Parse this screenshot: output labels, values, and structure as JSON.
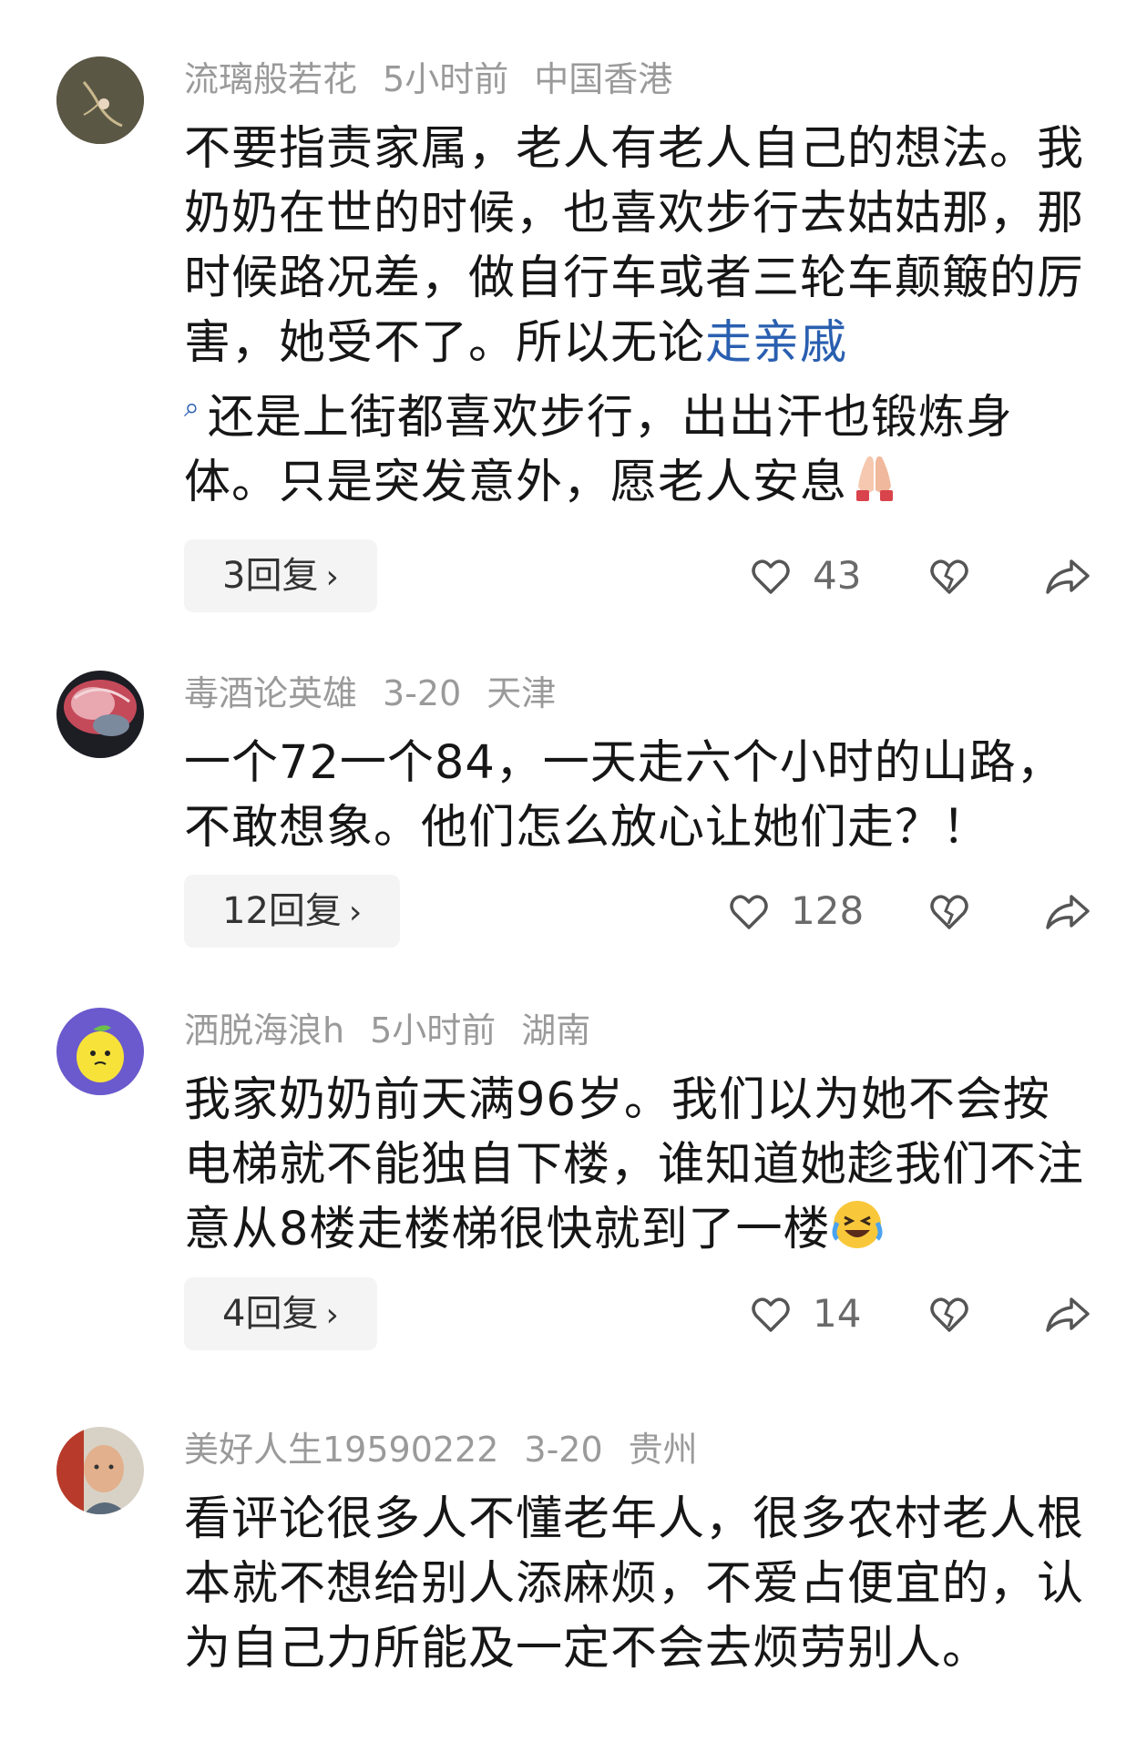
{
  "comments": [
    {
      "username": "流璃般若花",
      "time": "5小时前",
      "location": "中国香港",
      "text_part1": "不要指责家属，老人有老人自己的想法。我奶奶在世的时候，也喜欢步行去姑姑那，那时候路况差，做自行车或者三轮车颠簸的厉害，她受不了。所以无论",
      "link_text": "走亲戚",
      "text_part2": "还是上街都喜欢步行，出出汗也锻炼身体。只是突发意外，愿老人安息",
      "replies": "3回复",
      "likes": "43",
      "emoji": "praying-hands-emoji"
    },
    {
      "username": "毒酒论英雄",
      "time": "3-20",
      "location": "天津",
      "text": "一个72一个84，一天走六个小时的山路，不敢想象。他们怎么放心让她们走？！",
      "replies": "12回复",
      "likes": "128"
    },
    {
      "username": "洒脱海浪h",
      "time": "5小时前",
      "location": "湖南",
      "text": "我家奶奶前天满96岁。我们以为她不会按电梯就不能独自下楼，谁知道她趁我们不注意从8楼走楼梯很快就到了一楼",
      "replies": "4回复",
      "likes": "14",
      "emoji": "laughing-crying-emoji"
    },
    {
      "username": "美好人生19590222",
      "time": "3-20",
      "location": "贵州",
      "text": "看评论很多人不懂老年人，很多农村老人根本就不想给别人添麻烦，不爱占便宜的，认为自己力所能及一定不会去烦劳别人。"
    }
  ],
  "icons": {
    "like": "heart-icon",
    "dislike": "broken-heart-icon",
    "share": "share-arrow-icon",
    "search": "search-icon",
    "chevron": "chevron-right-icon"
  },
  "colors": {
    "link": "#2a5fb0",
    "meta": "#9a9a9a",
    "reply_bg": "#f4f4f4"
  }
}
